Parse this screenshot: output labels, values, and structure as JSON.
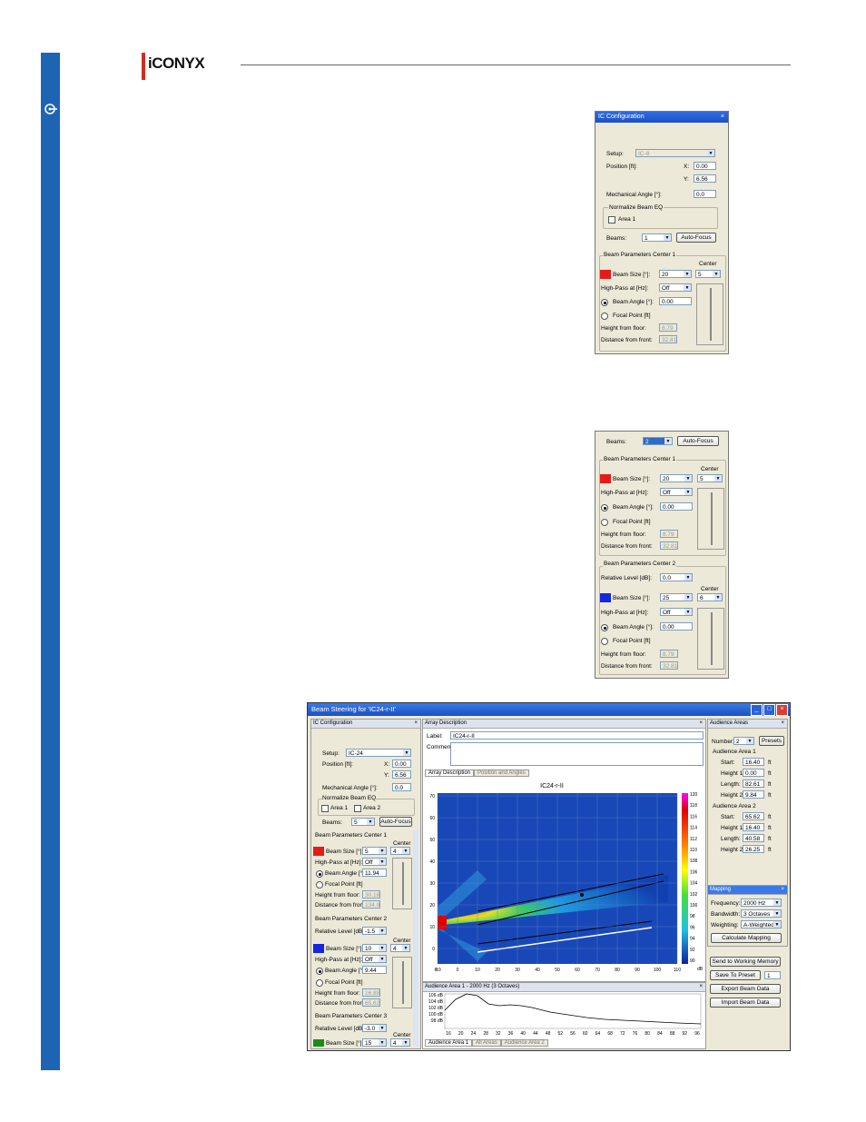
{
  "brand": {
    "logo_text": "iCONYX",
    "accent": "#1e64b4",
    "logo_red": "#d52b1e"
  },
  "panel1": {
    "title": "IC Configuration",
    "setup_label": "Setup:",
    "setup_value": "IC-8",
    "position_label": "Position [ft]:",
    "x_label": "X:",
    "x_value": "0.00",
    "y_label": "Y:",
    "y_value": "6.56",
    "mech_label": "Mechanical Angle [°]:",
    "mech_value": "0.0",
    "normalize_group": "Normalize Beam EQ",
    "area1_label": "Area 1",
    "beams_label": "Beams:",
    "beams_value": "1",
    "autofocus": "Auto-Focus",
    "center1": {
      "group": "Beam Parameters Center 1",
      "center_label": "Center",
      "center_value": "5",
      "beam_size_label": "Beam Size [°]:",
      "beam_size_value": "20",
      "highpass_label": "High-Pass at [Hz]:",
      "highpass_value": "Off",
      "beam_angle_label": "Beam Angle [°]:",
      "beam_angle_value": "0.00",
      "focal_label": "Focal Point [ft]",
      "height_label": "Height from floor:",
      "height_value": "8.79",
      "dist_label": "Distance from front:",
      "dist_value": "32.81"
    }
  },
  "panel2": {
    "beams_label": "Beams:",
    "beams_value": "2",
    "autofocus": "Auto-Focus",
    "center1": {
      "group": "Beam Parameters Center 1",
      "center_label": "Center",
      "center_value": "5",
      "beam_size_label": "Beam Size [°]:",
      "beam_size_value": "20",
      "highpass_label": "High-Pass at [Hz]:",
      "highpass_value": "Off",
      "beam_angle_label": "Beam Angle [°]:",
      "beam_angle_value": "0.00",
      "focal_label": "Focal Point [ft]",
      "height_label": "Height from floor:",
      "height_value": "8.79",
      "dist_label": "Distance from front:",
      "dist_value": "32.81"
    },
    "center2": {
      "group": "Beam Parameters Center 2",
      "rel_label": "Relative Level [dB]:",
      "rel_value": "0.0",
      "center_label": "Center",
      "center_value": "6",
      "beam_size_label": "Beam Size [°]:",
      "beam_size_value": "25",
      "highpass_label": "High-Pass at [Hz]:",
      "highpass_value": "Off",
      "beam_angle_label": "Beam Angle [°]:",
      "beam_angle_value": "0.00",
      "focal_label": "Focal Point [ft]",
      "height_label": "Height from floor:",
      "height_value": "8.79",
      "dist_label": "Distance from front:",
      "dist_value": "32.81"
    }
  },
  "main": {
    "title": "Beam Steering for 'IC24-r-II'",
    "left": {
      "title": "IC Configuration",
      "setup_label": "Setup:",
      "setup_value": "IC-24",
      "position_label": "Position [ft]:",
      "x_label": "X:",
      "x_value": "0.00",
      "y_label": "Y:",
      "y_value": "6.56",
      "mech_label": "Mechanical Angle [°]:",
      "mech_value": "0.0",
      "normalize_group": "Normalize Beam EQ",
      "area1": "Area 1",
      "area2": "Area 2",
      "beams_label": "Beams:",
      "beams_value": "5",
      "autofocus": "Auto-Focus",
      "c1_group": "Beam Parameters Center 1",
      "c1_center_label": "Center",
      "c1_center": "4",
      "c1_size_label": "Beam Size [°]:",
      "c1_size": "5",
      "c1_hp_label": "High-Pass at [Hz]:",
      "c1_hp": "Off",
      "c1_angle_label": "Beam Angle [°]:",
      "c1_angle": "11.94",
      "c1_focal": "Focal Point [ft]",
      "c1_h_label": "Height from floor:",
      "c1_h": "30.18",
      "c1_d_label": "Distance from front:",
      "c1_d": "134.99",
      "c2_group": "Beam Parameters Center 2",
      "c2_rel_label": "Relative Level [dB]:",
      "c2_rel": "-1.5",
      "c2_center_label": "Center",
      "c2_center": "4",
      "c2_size_label": "Beam Size [°]:",
      "c2_size": "10",
      "c2_hp_label": "High-Pass at [Hz]:",
      "c2_hp": "Off",
      "c2_angle_label": "Beam Angle [°]:",
      "c2_angle": "9.44",
      "c2_focal": "Focal Point [ft]",
      "c2_h_label": "Height from floor:",
      "c2_h": "16.88",
      "c2_d_label": "Distance from front:",
      "c2_d": "65.62",
      "c3_group": "Beam Parameters Center 3",
      "c3_rel_label": "Relative Level [dB]:",
      "c3_rel": "-3.0",
      "c3_center_label": "Center",
      "c3_center": "4",
      "c3_size_label": "Beam Size [°]:",
      "c3_size": "15"
    },
    "array": {
      "title": "Array Description",
      "label_label": "Label:",
      "label_value": "IC24-r-II",
      "comments_label": "Comments:",
      "tabs": [
        "Array Description",
        "Position and Angles"
      ],
      "plot_title": "IC24-r-II",
      "x_unit": "ft",
      "y_ticks": [
        "70",
        "60",
        "50",
        "40",
        "30",
        "20",
        "10",
        "0"
      ],
      "x_ticks": [
        "-10",
        "0",
        "10",
        "20",
        "30",
        "40",
        "50",
        "60",
        "70",
        "80",
        "90",
        "100",
        "110"
      ],
      "cb_ticks": [
        "120",
        "118",
        "116",
        "114",
        "112",
        "110",
        "108",
        "106",
        "104",
        "102",
        "100",
        "98",
        "96",
        "94",
        "92",
        "90"
      ],
      "cb_unit": "dB"
    },
    "response": {
      "title": "Audience Area 1 - 2000 Hz (3 Octaves)",
      "y_ticks": [
        "106 dB",
        "104 dB",
        "102 dB",
        "100 dB",
        "98 dB"
      ],
      "x_ticks": [
        "16",
        "20",
        "24",
        "28",
        "32",
        "36",
        "40",
        "44",
        "48",
        "52",
        "56",
        "60",
        "64",
        "68",
        "72",
        "76",
        "80",
        "84",
        "88",
        "92",
        "96"
      ],
      "tabs": [
        "Audience Area 1",
        "All Areas",
        "Audience Area 2"
      ]
    },
    "areas": {
      "title": "Audience Areas",
      "number_label": "Number:",
      "number_value": "2",
      "presets": "Presets",
      "a1_group": "Audience Area 1",
      "a1_start_label": "Start:",
      "a1_start": "16.40",
      "a1_h1_label": "Height 1:",
      "a1_h1": "0.00",
      "a1_len_label": "Length:",
      "a1_len": "82.61",
      "a1_h2_label": "Height 2:",
      "a1_h2": "9.84",
      "a2_group": "Audience Area 2",
      "a2_start_label": "Start:",
      "a2_start": "65.62",
      "a2_h1_label": "Height 1:",
      "a2_h1": "16.40",
      "a2_len_label": "Length:",
      "a2_len": "40.58",
      "a2_h2_label": "Height 2:",
      "a2_h2": "26.25",
      "unit": "ft"
    },
    "mapping": {
      "title": "Mapping",
      "freq_label": "Frequency:",
      "freq": "2000 Hz",
      "bw_label": "Bandwidth:",
      "bw": "3 Octaves",
      "wt_label": "Weighting:",
      "wt": "A-Weighted",
      "calc": "Calculate Mapping",
      "send": "Send to Working Memory",
      "save": "Save To Preset",
      "preset_no": "1",
      "export": "Export Beam Data",
      "import": "Import Beam Data"
    }
  },
  "colors": {
    "red": "#e51b1b",
    "blue": "#1326e0",
    "green": "#1a8c1a"
  }
}
